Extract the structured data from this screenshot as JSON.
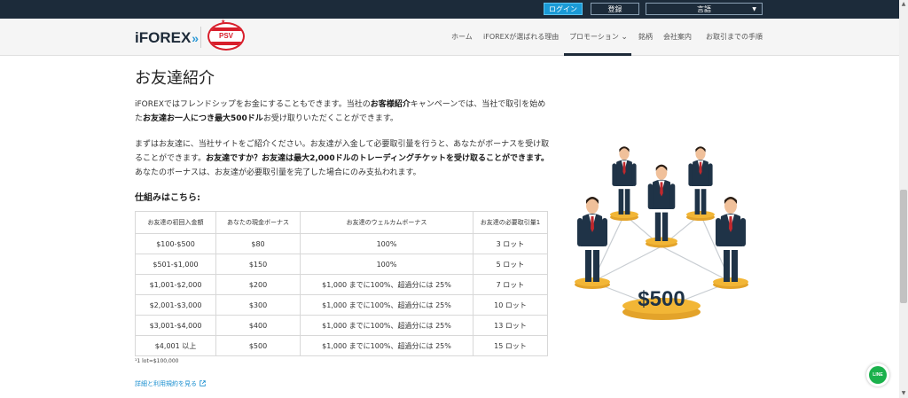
{
  "topbar": {
    "login_label": "ログイン",
    "register_label": "登録",
    "language_label": "言語"
  },
  "brand": {
    "logo_text": "iFOREX",
    "partner_badge_text": "PSV"
  },
  "nav": {
    "items": [
      {
        "label": "ホーム"
      },
      {
        "label": "iFOREXが選ばれる理由"
      },
      {
        "label": "プロモーション"
      },
      {
        "label": "銘柄"
      },
      {
        "label": "会社案内"
      },
      {
        "label": "お取引までの手順"
      }
    ],
    "active_index": 2
  },
  "page": {
    "title": "お友達紹介",
    "para1_a": "iFOREXではフレンドシップをお金にすることもできます。当社の",
    "para1_b": "お客様紹介",
    "para1_c": "キャンペーンでは、当社で取引を始めた",
    "para1_d": "お友達お一人につき最大500ドル",
    "para1_e": "お受け取りいただくことができます。",
    "para2_a": "まずはお友達に、当社サイトをご紹介ください。お友達が入金して必要取引量を行うと、あなたがボーナスを受け取ることができます。",
    "para2_b": "お友達ですか？お友達は最大2,000ドルのトレーディングチケットを受け取ることができます。",
    "para2_c": "あなたのボーナスは、お友達が必要取引量を完了した場合にのみ支払われます。",
    "subheading": "仕組みはこちら:",
    "footnote": "¹1 lot=$100,000",
    "terms_link": "詳細と利用規約を見る"
  },
  "table": {
    "headers": [
      "お友達の初回入金額",
      "あなたの現金ボーナス",
      "お友達のウェルカムボーナス",
      "お友達の必要取引量1"
    ],
    "rows": [
      [
        "$100-$500",
        "$80",
        "100%",
        "3 ロット"
      ],
      [
        "$501-$1,000",
        "$150",
        "100%",
        "5 ロット"
      ],
      [
        "$1,001-$2,000",
        "$200",
        "$1,000 までに100%、超過分には 25%",
        "7 ロット"
      ],
      [
        "$2,001-$3,000",
        "$300",
        "$1,000 までに100%、超過分には 25%",
        "10 ロット"
      ],
      [
        "$3,001-$4,000",
        "$400",
        "$1,000 までに100%、超過分には 25%",
        "13 ロット"
      ],
      [
        "$4,001 以上",
        "$500",
        "$1,000 までに100%、超過分には 25%",
        "15 ロット"
      ]
    ]
  },
  "illustration": {
    "amount_label": "$500",
    "platform_color": "#f2b636",
    "suit_color": "#1f3347",
    "tie_color": "#c0282d"
  },
  "chat": {
    "label": "LINE",
    "color": "#1bb14c"
  }
}
